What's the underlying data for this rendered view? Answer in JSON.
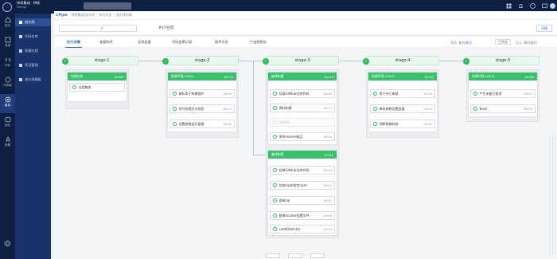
{
  "app": {
    "brand_line1": "持续集成 · 持续",
    "brand_line2": "DevOps"
  },
  "rail": [
    {
      "label": "首页",
      "icon": "home-icon"
    },
    {
      "label": "资源",
      "icon": "box-icon"
    },
    {
      "label": "代码",
      "icon": "code-icon"
    },
    {
      "label": "代码库",
      "icon": "repo-icon"
    },
    {
      "label": "集成",
      "icon": "build-icon"
    },
    {
      "label": "制品",
      "icon": "package-icon"
    },
    {
      "label": "部署",
      "icon": "rocket-icon"
    }
  ],
  "sidebar": [
    {
      "label": "流水线"
    },
    {
      "label": "代码仓库"
    },
    {
      "label": "质量红线"
    },
    {
      "label": "凭证管理"
    },
    {
      "label": "流水线模板"
    }
  ],
  "breadcrumb": {
    "logo": "CPipe",
    "items": [
      "持续集成/流水线",
      "执行历史",
      "流水线详情"
    ]
  },
  "header": {
    "pipeline_value": "n",
    "run_number": "#37/已完",
    "run_button": "详情"
  },
  "tabs": [
    "执行详情",
    "查看构件",
    "全局变量",
    "代码变更记录",
    "插件任务",
    "产出物报告"
  ],
  "filters": {
    "left_label": "筛选:",
    "left_value": "执行成功",
    "right_label": "显示:",
    "right_value": "执行成功",
    "chip": "已完成"
  },
  "stages": [
    {
      "name": "stage-1",
      "jobs": [
        {
          "title": "构建任务",
          "time": "00:06",
          "steps": [
            {
              "text": "远程触发",
              "time": ""
            }
          ]
        }
      ]
    },
    {
      "name": "stage-2",
      "jobs": [
        {
          "title": "构建环境-LINUX",
          "time": "00:34",
          "steps": [
            {
              "text": "解析用于构建插件",
              "time": "00:09"
            },
            {
              "text": "合代码提交与校验",
              "time": "00:14"
            },
            {
              "text": "设置参数运行变量",
              "time": "00:00"
            }
          ]
        }
      ]
    },
    {
      "name": "stage-3",
      "jobs": [
        {
          "title": "编译构建",
          "time": "04:29",
          "steps": [
            {
              "text": "拉取GitHub仓库代码",
              "time": "00:30"
            },
            {
              "text": "源码构建",
              "time": "00:17"
            },
            {
              "text": "SONAR",
              "time": "",
              "faded": true
            },
            {
              "text": "发布maven制品",
              "time": "00:04"
            }
          ]
        },
        {
          "title": "编译构建",
          "time": "03:01",
          "steps": [
            {
              "text": "拉取GitHub仓库代码",
              "time": "00:04"
            },
            {
              "text": "拉取zip安装包/rpm",
              "time": "00:02"
            },
            {
              "text": "安装zip",
              "time": "00:01"
            },
            {
              "text": "替换master配置文件",
              "time": "00:00"
            },
            {
              "text": "codeDetector",
              "time": "00:14"
            }
          ]
        }
      ]
    },
    {
      "name": "stage-4",
      "jobs": [
        {
          "title": "构建环境-LINUX",
          "time": "01:02",
          "steps": [
            {
              "text": "用于中心审核",
              "time": "01:00"
            },
            {
              "text": "审核参数设置变量",
              "time": "00:00"
            },
            {
              "text": "判断镜像状态",
              "time": "00:01"
            }
          ]
        }
      ]
    },
    {
      "name": "stage-5",
      "jobs": [
        {
          "title": "构建环境-LINUX",
          "time": "00:06",
          "steps": [
            {
              "text": "产生未能已使用",
              "time": "00:01"
            },
            {
              "text": "Bash",
              "time": "00:00"
            }
          ]
        }
      ]
    }
  ],
  "colors": {
    "success": "#38c06a",
    "accent": "#2f6fd6",
    "nav": "#0e1f44"
  }
}
